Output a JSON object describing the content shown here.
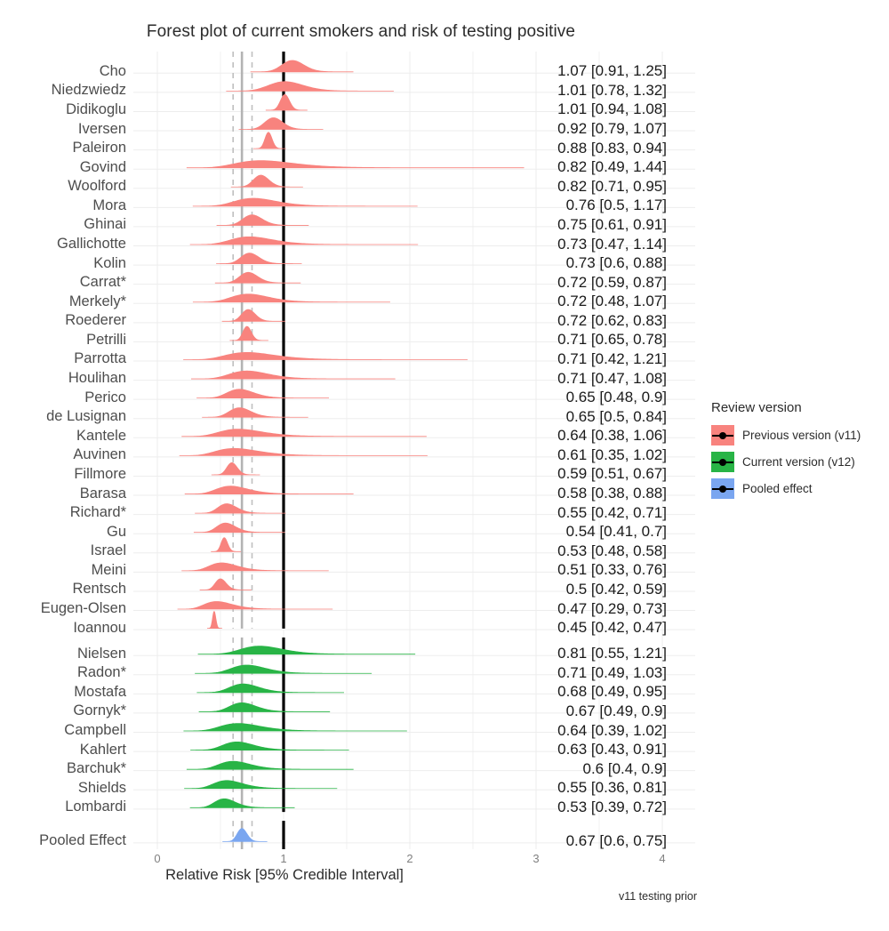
{
  "title": "Forest plot of current smokers and risk of testing positive",
  "axis": {
    "xlabel": "Relative Risk [95% Credible Interval]",
    "ticks": [
      "0",
      "1",
      "2",
      "3",
      "4"
    ],
    "tick_values": [
      0,
      1,
      2,
      3,
      4
    ],
    "xlim": [
      -0.07,
      4.2
    ],
    "null_line": 1
  },
  "caption": "v11 testing prior",
  "legend": {
    "title": "Review version",
    "items": [
      {
        "label": "Previous version (v11)",
        "color": "#F8837E"
      },
      {
        "label": "Current version (v12)",
        "color": "#28B446"
      },
      {
        "label": "Pooled effect",
        "color": "#7AA6F0"
      }
    ]
  },
  "colors": {
    "previous": "#F8837E",
    "current": "#28B446",
    "pooled": "#7AA6F0",
    "null_line": "#000000",
    "pooled_line": "#B3B3B3",
    "pooled_ci_line": "#BFBFBF",
    "panel": "#FFFFFF",
    "gridline": "#EDEDED"
  },
  "reference_lines": {
    "pooled_estimate": 0.67,
    "pooled_ci_low": 0.6,
    "pooled_ci_high": 0.75
  },
  "chart_data": {
    "type": "forest",
    "title": "Forest plot of current smokers and risk of testing positive",
    "xlabel": "Relative Risk [95% Credible Interval]",
    "ylabel": "",
    "xlim": [
      0,
      4
    ],
    "grid": true,
    "legend_position": "right",
    "groups": [
      {
        "name": "Previous version (v11)",
        "color": "#F8837E",
        "rows": [
          {
            "study": "Cho",
            "estimate": 1.07,
            "low": 0.91,
            "high": 1.25,
            "text": "1.07 [0.91, 1.25]"
          },
          {
            "study": "Niedzwiedz",
            "estimate": 1.01,
            "low": 0.78,
            "high": 1.32,
            "text": "1.01 [0.78, 1.32]"
          },
          {
            "study": "Didikoglu",
            "estimate": 1.01,
            "low": 0.94,
            "high": 1.08,
            "text": "1.01 [0.94, 1.08]"
          },
          {
            "study": "Iversen",
            "estimate": 0.92,
            "low": 0.79,
            "high": 1.07,
            "text": "0.92 [0.79, 1.07]"
          },
          {
            "study": "Paleiron",
            "estimate": 0.88,
            "low": 0.83,
            "high": 0.94,
            "text": "0.88 [0.83, 0.94]"
          },
          {
            "study": "Govind",
            "estimate": 0.82,
            "low": 0.49,
            "high": 1.44,
            "text": "0.82 [0.49, 1.44]"
          },
          {
            "study": "Woolford",
            "estimate": 0.82,
            "low": 0.71,
            "high": 0.95,
            "text": "0.82 [0.71, 0.95]"
          },
          {
            "study": "Mora",
            "estimate": 0.76,
            "low": 0.5,
            "high": 1.17,
            "text": "0.76 [0.5, 1.17]"
          },
          {
            "study": "Ghinai",
            "estimate": 0.75,
            "low": 0.61,
            "high": 0.91,
            "text": "0.75 [0.61, 0.91]"
          },
          {
            "study": "Gallichotte",
            "estimate": 0.73,
            "low": 0.47,
            "high": 1.14,
            "text": "0.73 [0.47, 1.14]"
          },
          {
            "study": "Kolin",
            "estimate": 0.73,
            "low": 0.6,
            "high": 0.88,
            "text": "0.73 [0.6, 0.88]"
          },
          {
            "study": "Carrat*",
            "estimate": 0.72,
            "low": 0.59,
            "high": 0.87,
            "text": "0.72 [0.59, 0.87]"
          },
          {
            "study": "Merkely*",
            "estimate": 0.72,
            "low": 0.48,
            "high": 1.07,
            "text": "0.72 [0.48, 1.07]"
          },
          {
            "study": "Roederer",
            "estimate": 0.72,
            "low": 0.62,
            "high": 0.83,
            "text": "0.72 [0.62, 0.83]"
          },
          {
            "study": "Petrilli",
            "estimate": 0.71,
            "low": 0.65,
            "high": 0.78,
            "text": "0.71 [0.65, 0.78]"
          },
          {
            "study": "Parrotta",
            "estimate": 0.71,
            "low": 0.42,
            "high": 1.21,
            "text": "0.71 [0.42, 1.21]"
          },
          {
            "study": "Houlihan",
            "estimate": 0.71,
            "low": 0.47,
            "high": 1.08,
            "text": "0.71 [0.47, 1.08]"
          },
          {
            "study": "Perico",
            "estimate": 0.65,
            "low": 0.48,
            "high": 0.9,
            "text": "0.65 [0.48, 0.9]"
          },
          {
            "study": "de Lusignan",
            "estimate": 0.65,
            "low": 0.5,
            "high": 0.84,
            "text": "0.65 [0.5, 0.84]"
          },
          {
            "study": "Kantele",
            "estimate": 0.64,
            "low": 0.38,
            "high": 1.06,
            "text": "0.64 [0.38, 1.06]"
          },
          {
            "study": "Auvinen",
            "estimate": 0.61,
            "low": 0.35,
            "high": 1.02,
            "text": "0.61 [0.35, 1.02]"
          },
          {
            "study": "Fillmore",
            "estimate": 0.59,
            "low": 0.51,
            "high": 0.67,
            "text": "0.59 [0.51, 0.67]"
          },
          {
            "study": "Barasa",
            "estimate": 0.58,
            "low": 0.38,
            "high": 0.88,
            "text": "0.58 [0.38, 0.88]"
          },
          {
            "study": "Richard*",
            "estimate": 0.55,
            "low": 0.42,
            "high": 0.71,
            "text": "0.55 [0.42, 0.71]"
          },
          {
            "study": "Gu",
            "estimate": 0.54,
            "low": 0.41,
            "high": 0.7,
            "text": "0.54 [0.41, 0.7]"
          },
          {
            "study": "Israel",
            "estimate": 0.53,
            "low": 0.48,
            "high": 0.58,
            "text": "0.53 [0.48, 0.58]"
          },
          {
            "study": "Meini",
            "estimate": 0.51,
            "low": 0.33,
            "high": 0.76,
            "text": "0.51 [0.33, 0.76]"
          },
          {
            "study": "Rentsch",
            "estimate": 0.5,
            "low": 0.42,
            "high": 0.59,
            "text": "0.5 [0.42, 0.59]"
          },
          {
            "study": "Eugen-Olsen",
            "estimate": 0.47,
            "low": 0.29,
            "high": 0.73,
            "text": "0.47 [0.29, 0.73]"
          },
          {
            "study": "Ioannou",
            "estimate": 0.45,
            "low": 0.42,
            "high": 0.47,
            "text": "0.45 [0.42, 0.47]"
          }
        ]
      },
      {
        "name": "Current version (v12)",
        "color": "#28B446",
        "rows": [
          {
            "study": "Nielsen",
            "estimate": 0.81,
            "low": 0.55,
            "high": 1.21,
            "text": "0.81 [0.55, 1.21]"
          },
          {
            "study": "Radon*",
            "estimate": 0.71,
            "low": 0.49,
            "high": 1.03,
            "text": "0.71 [0.49, 1.03]"
          },
          {
            "study": "Mostafa",
            "estimate": 0.68,
            "low": 0.49,
            "high": 0.95,
            "text": "0.68 [0.49, 0.95]"
          },
          {
            "study": "Gornyk*",
            "estimate": 0.67,
            "low": 0.49,
            "high": 0.9,
            "text": "0.67 [0.49, 0.9]"
          },
          {
            "study": "Campbell",
            "estimate": 0.64,
            "low": 0.39,
            "high": 1.02,
            "text": "0.64 [0.39, 1.02]"
          },
          {
            "study": "Kahlert",
            "estimate": 0.63,
            "low": 0.43,
            "high": 0.91,
            "text": "0.63 [0.43, 0.91]"
          },
          {
            "study": "Barchuk*",
            "estimate": 0.6,
            "low": 0.4,
            "high": 0.9,
            "text": "0.6 [0.4, 0.9]"
          },
          {
            "study": "Shields",
            "estimate": 0.55,
            "low": 0.36,
            "high": 0.81,
            "text": "0.55 [0.36, 0.81]"
          },
          {
            "study": "Lombardi",
            "estimate": 0.53,
            "low": 0.39,
            "high": 0.72,
            "text": "0.53 [0.39, 0.72]"
          }
        ]
      },
      {
        "name": "Pooled effect",
        "color": "#7AA6F0",
        "rows": [
          {
            "study": "Pooled Effect",
            "estimate": 0.67,
            "low": 0.6,
            "high": 0.75,
            "text": "0.67 [0.6, 0.75]"
          }
        ]
      }
    ]
  }
}
